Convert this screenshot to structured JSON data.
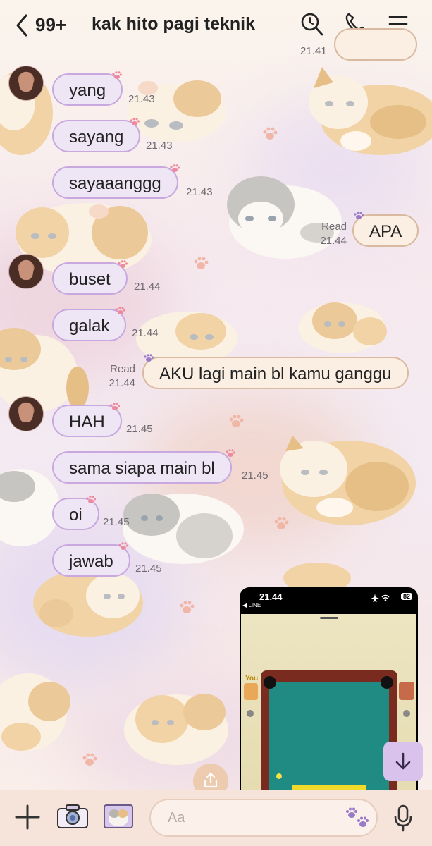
{
  "header": {
    "unread_count": "99+",
    "chat_title": "kak hito pagi teknik"
  },
  "partial_time": "21.41",
  "messages": [
    {
      "text": "yang",
      "time": "21.43"
    },
    {
      "text": "sayang",
      "time": "21.43"
    },
    {
      "text": "sayaaanggg",
      "time": "21.43"
    },
    {
      "text": "APA",
      "time": "21.44",
      "status": "Read"
    },
    {
      "text": "buset",
      "time": "21.44"
    },
    {
      "text": "galak",
      "time": "21.44"
    },
    {
      "text": "AKU lagi main bl kamu ganggu",
      "time": "21.44",
      "status": "Read"
    },
    {
      "text": "HAH",
      "time": "21.45"
    },
    {
      "text": "sama siapa main bl",
      "time": "21.45"
    },
    {
      "text": "oi",
      "time": "21.45"
    },
    {
      "text": "jawab",
      "time": "21.45"
    }
  ],
  "screenshot": {
    "status_time": "21.44",
    "app_label": "◀ LINE",
    "battery": "82",
    "player_label": "You"
  },
  "input": {
    "placeholder": "Aa"
  },
  "icons": {
    "back": "chevron-left-icon",
    "search": "search-icon",
    "call": "phone-icon",
    "menu": "hamburger-icon",
    "add": "plus-icon",
    "camera": "camera-icon",
    "gallery": "image-icon",
    "sticker": "paw-icon",
    "voice": "microphone-icon",
    "scroll_down": "arrow-down-icon",
    "share": "share-icon"
  },
  "colors": {
    "incoming_bubble": "#efe6f5",
    "incoming_border": "#c8a8de",
    "outgoing_bubble": "#fbefe4",
    "outgoing_border": "#d9b9a0"
  }
}
